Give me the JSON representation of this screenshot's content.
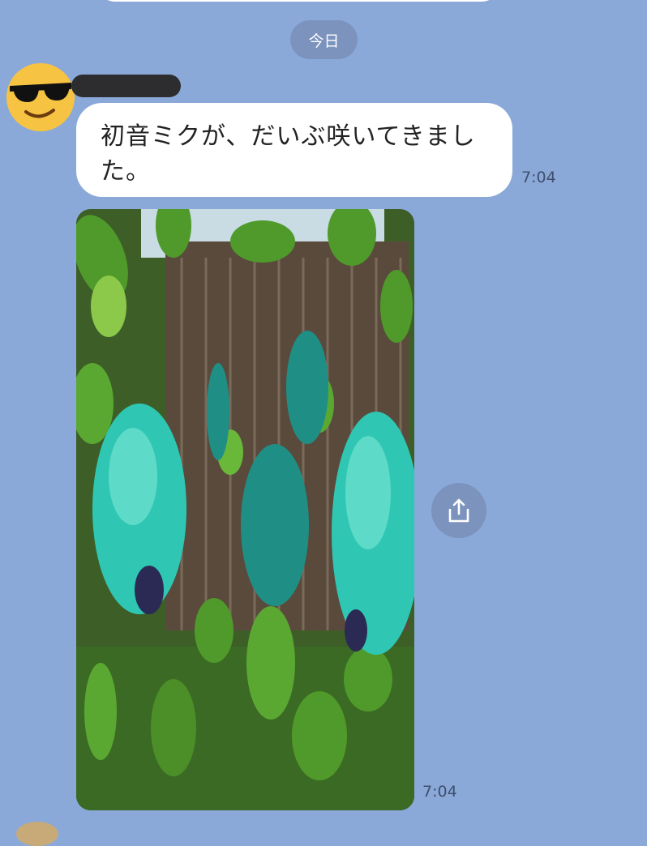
{
  "chat": {
    "date_divider": "今日",
    "message": {
      "text": "初音ミクが、だいぶ咲いてきました。",
      "time": "7:04"
    },
    "photo_message": {
      "time": "7:04"
    }
  },
  "icons": {
    "avatar": "sunglasses-emoji-icon",
    "share": "share-upload-icon"
  },
  "colors": {
    "background": "#8aa9d9",
    "bubble": "#ffffff",
    "pill": "#7b93bd",
    "avatar": "#f6c342",
    "flower": "#2fc7b3",
    "leaf": "#4f9a2a"
  }
}
